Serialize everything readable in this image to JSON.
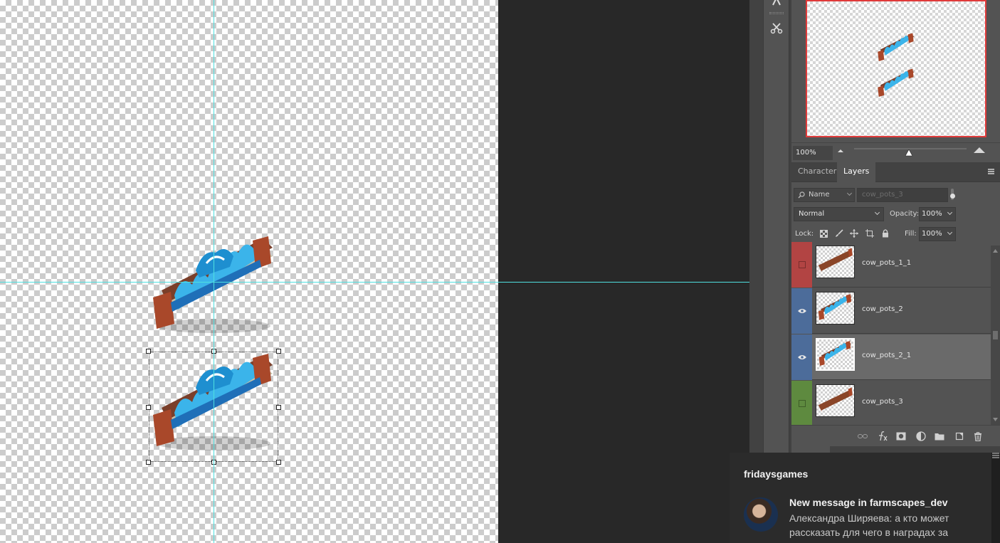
{
  "navigator": {
    "zoom": "100%"
  },
  "panel": {
    "tabs": [
      {
        "label": "Character",
        "active": false
      },
      {
        "label": "Layers",
        "active": true
      }
    ]
  },
  "layers": {
    "filter_kind": "Name",
    "filter_text": "cow_pots_3",
    "blend_mode": "Normal",
    "opacity_label": "Opacity:",
    "opacity": "100%",
    "lock_label": "Lock:",
    "fill_label": "Fill:",
    "fill": "100%",
    "items": [
      {
        "name": "cow_pots_1_1",
        "visible": false,
        "color": "#b24443",
        "selected": false
      },
      {
        "name": "cow_pots_2",
        "visible": true,
        "color": "#4c6c9a",
        "selected": false
      },
      {
        "name": "cow_pots_2_1",
        "visible": true,
        "color": "#4c6c9a",
        "selected": true
      },
      {
        "name": "cow_pots_3",
        "visible": false,
        "color": "#5e8a3f",
        "selected": false
      }
    ]
  },
  "notification": {
    "app": "fridaysgames",
    "heading": "New message in farmscapes_dev",
    "body": "Александра Ширяева: а кто может рассказать для чего в наградах за"
  },
  "colors": {
    "guide": "#4fe0e0",
    "navigator_frame": "#e03a3a"
  }
}
